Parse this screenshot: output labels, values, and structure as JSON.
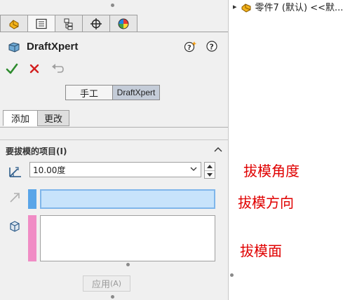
{
  "feature_manager_tabs": [
    {
      "name": "property-manager",
      "icon": "featuremanager-part-icon"
    },
    {
      "name": "property-list",
      "icon": "propertymanager-icon"
    },
    {
      "name": "configuration",
      "icon": "configuration-manager-icon"
    },
    {
      "name": "dimxpert",
      "icon": "dimxpert-crosshair-icon"
    },
    {
      "name": "display",
      "icon": "display-manager-icon"
    }
  ],
  "panel": {
    "title": "DraftXpert",
    "help_icon": "help-question-icon",
    "whats_wrong_icon": "whats-new-icon"
  },
  "actions": {
    "ok": "ok-check-icon",
    "cancel": "cancel-x-icon",
    "undo": "undo-icon"
  },
  "mode": {
    "manual_label": "手工",
    "draftxpert_label": "DraftXpert",
    "selected": "DraftXpert"
  },
  "subtabs": {
    "add_label": "添加",
    "change_label": "更改",
    "selected": "添加"
  },
  "group": {
    "title": "要拔模的项目(I)",
    "draft_angle_value": "10.00度",
    "colors": {
      "direction": "#5aa5e8",
      "faces": "#f08cc5"
    }
  },
  "apply": {
    "label": "应用",
    "accelerator": "(A)"
  },
  "annotations": {
    "angle": "拔模角度",
    "direction": "拔模方向",
    "faces": "拔模面",
    "color": "#e00000"
  },
  "tree": {
    "expand_glyph": "▸",
    "root_label": "零件7 (默认) <<默..."
  }
}
